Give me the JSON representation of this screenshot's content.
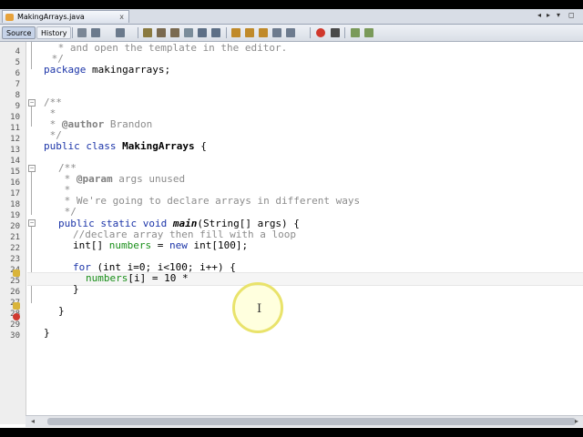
{
  "editor": {
    "file_tab": "MakingArrays.java",
    "tab_close": "x",
    "tab_nav_left": "◂",
    "tab_nav_right": "▸",
    "tab_menu": "▾",
    "tab_restore": "◻"
  },
  "toolbar": {
    "source_label": "Source",
    "history_label": "History"
  },
  "gutter": {
    "line_numbers": [
      "4",
      "5",
      "6",
      "7",
      "8",
      "9",
      "10",
      "11",
      "12",
      "13",
      "14",
      "15",
      "16",
      "17",
      "18",
      "19",
      "20",
      "21",
      "22",
      "23",
      "24",
      "25",
      "26",
      "27",
      "28",
      "29",
      "30"
    ]
  },
  "code": {
    "l4_a": " * and open the template in the editor.",
    "l5": " */",
    "l6_kw": "package",
    "l6_rest": " makingarrays;",
    "l8": "/**",
    "l9": " *",
    "l10_star": " * ",
    "l10_tag": "@author",
    "l10_rest": " Brandon",
    "l11": " */",
    "l12_kw": "public class",
    "l12_name": " MakingArrays",
    "l12_rest": " {",
    "l14": "/**",
    "l15_star": " * ",
    "l15_tag": "@param",
    "l15_rest": " args unused",
    "l16": " *",
    "l17": " * We're going to declare arrays in different ways",
    "l18": " */",
    "l19_kw": "public static void",
    "l19_name": " main",
    "l19_rest": "(String[] args) {",
    "l20": "//declare array then fill with a loop",
    "l21_a": "int[] ",
    "l21_field": "numbers",
    "l21_b": " = ",
    "l21_kw": "new",
    "l21_c": " int[100];",
    "l23_kw": "for",
    "l23_rest": " (int i=0; i<100; i++) {",
    "l24_field": "numbers",
    "l24_rest": "[i] = 10 *",
    "l25": "}",
    "l27": "}",
    "l29": "}"
  },
  "scrollbar": {
    "left_arrow": "◂",
    "right_arrow": "▸"
  },
  "cursor": {
    "ibeam": "I"
  }
}
